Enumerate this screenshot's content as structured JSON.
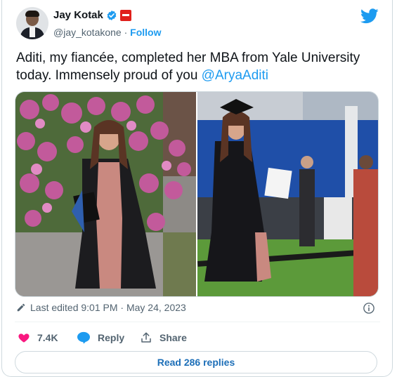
{
  "author": {
    "name": "Jay Kotak",
    "handle": "@jay_kotakone",
    "separator": "·",
    "follow_label": "Follow"
  },
  "tweet": {
    "text_before": "Aditi, my fiancée, completed her MBA from Yale University today. Immensely proud of you ",
    "mention": "@AryaAditi"
  },
  "meta": {
    "edited_label": "Last edited 9:01 PM · May 24, 2023"
  },
  "actions": {
    "likes": "7.4K",
    "reply_label": "Reply",
    "share_label": "Share"
  },
  "read_replies_label": "Read 286 replies",
  "colors": {
    "accent": "#1d9bf0",
    "like": "#f91880",
    "text": "#0f1419",
    "muted": "#536471"
  }
}
